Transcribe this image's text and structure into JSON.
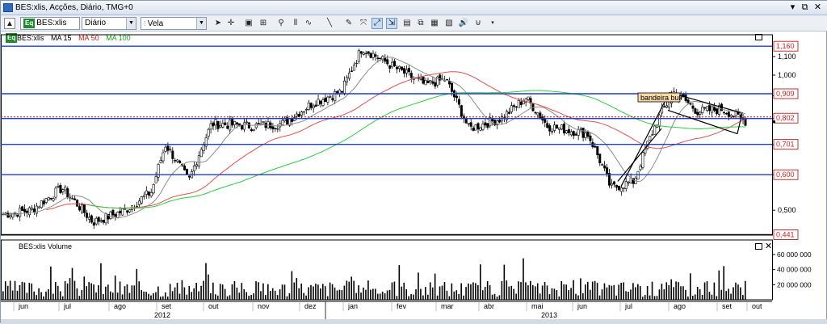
{
  "window": {
    "title": "BES:xlis, Acções, Diário, TMG+0"
  },
  "toolbar": {
    "symbol": "BES:xlis",
    "periodicity": "Diário",
    "chart_style": "Vela",
    "tools": [
      "cursor-icon",
      "crosshair-icon",
      "data-window-icon",
      "indicators-icon",
      "zoom-icon",
      "bars-icon",
      "line-studies-icon",
      "trendline-icon",
      "drawing-icon",
      "auto-scroll-icon",
      "auto-scale-icon",
      "layout-icon",
      "copy-icon",
      "template-icon",
      "pattern-icon",
      "sound-icon",
      "magnet-icon"
    ]
  },
  "legend": {
    "symbol": "BES:xlis",
    "ma15": "MA 15",
    "ma50": "MA 50",
    "ma100": "MA 100"
  },
  "colors": {
    "candle": "#000000",
    "ma15": "#8c8c8c",
    "ma50": "#e05050",
    "ma100": "#2ecc40",
    "hline": "#1f3fbf",
    "price_label_text": "#d42020"
  },
  "chart_data": {
    "type": "candlestick",
    "symbol": "BES:xlis",
    "y_axis_ticks": [
      "0,500",
      "0,600",
      "0,700",
      "0,800",
      "0,900",
      "1,000",
      "1,100"
    ],
    "y_axis_tick_values": [
      0.5,
      0.6,
      0.7,
      0.8,
      0.9,
      1.0,
      1.1
    ],
    "price_scale": "log",
    "ylim": [
      0.44,
      1.2
    ],
    "horizontal_levels": [
      {
        "label": "1,160",
        "value": 1.16
      },
      {
        "label": "0,909",
        "value": 0.909
      },
      {
        "label": "0,802",
        "value": 0.802,
        "style": "dotted-red"
      },
      {
        "label": "0,701",
        "value": 0.701
      },
      {
        "label": "0,600",
        "value": 0.6
      },
      {
        "label": "0,441",
        "value": 0.441
      }
    ],
    "current_price": 0.787,
    "annotation": "bandeira bull",
    "x_labels": [
      "2012",
      "jun",
      "jul",
      "ago",
      "set",
      "out",
      "nov",
      "dez",
      "jan",
      "fev",
      "mar",
      "abr",
      "mai",
      "jun",
      "jul",
      "ago",
      "set",
      "out"
    ],
    "year_labels": [
      "2012",
      "2013"
    ],
    "close_anchors": [
      {
        "m": "2012-05-28",
        "v": 0.49
      },
      {
        "m": "2012-06-15",
        "v": 0.5
      },
      {
        "m": "2012-07-05",
        "v": 0.56
      },
      {
        "m": "2012-07-25",
        "v": 0.47
      },
      {
        "m": "2012-08-15",
        "v": 0.5
      },
      {
        "m": "2012-09-01",
        "v": 0.55
      },
      {
        "m": "2012-09-10",
        "v": 0.7
      },
      {
        "m": "2012-09-25",
        "v": 0.58
      },
      {
        "m": "2012-10-10",
        "v": 0.78
      },
      {
        "m": "2012-11-05",
        "v": 0.77
      },
      {
        "m": "2012-11-25",
        "v": 0.78
      },
      {
        "m": "2012-12-15",
        "v": 0.87
      },
      {
        "m": "2013-01-02",
        "v": 0.92
      },
      {
        "m": "2013-01-15",
        "v": 1.15
      },
      {
        "m": "2013-02-05",
        "v": 1.04
      },
      {
        "m": "2013-02-25",
        "v": 0.95
      },
      {
        "m": "2013-03-10",
        "v": 0.98
      },
      {
        "m": "2013-03-25",
        "v": 0.76
      },
      {
        "m": "2013-04-15",
        "v": 0.8
      },
      {
        "m": "2013-05-01",
        "v": 0.89
      },
      {
        "m": "2013-05-15",
        "v": 0.77
      },
      {
        "m": "2013-06-10",
        "v": 0.74
      },
      {
        "m": "2013-06-25",
        "v": 0.56
      },
      {
        "m": "2013-07-10",
        "v": 0.58
      },
      {
        "m": "2013-07-25",
        "v": 0.79
      },
      {
        "m": "2013-08-05",
        "v": 0.92
      },
      {
        "m": "2013-08-20",
        "v": 0.83
      },
      {
        "m": "2013-09-05",
        "v": 0.84
      },
      {
        "m": "2013-09-20",
        "v": 0.79
      }
    ],
    "volume_pane": {
      "label": "BES:xlis Volume",
      "y_axis_ticks": [
        "20 000 000",
        "40 000 000",
        "60 000 000"
      ],
      "y_axis_tick_values": [
        20000000,
        40000000,
        60000000
      ]
    }
  }
}
